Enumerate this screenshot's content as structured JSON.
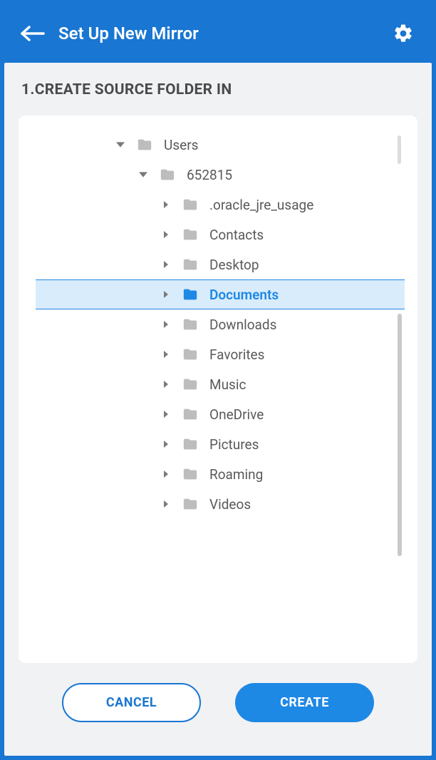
{
  "header": {
    "title": "Set Up New Mirror"
  },
  "section": {
    "title": "1.CREATE SOURCE FOLDER IN"
  },
  "tree": {
    "selectedIndex": 5,
    "nodes": [
      {
        "label": "Users",
        "depth": 0,
        "expanded": true
      },
      {
        "label": "652815",
        "depth": 1,
        "expanded": true
      },
      {
        "label": ".oracle_jre_usage",
        "depth": 2,
        "expanded": false
      },
      {
        "label": "Contacts",
        "depth": 2,
        "expanded": false
      },
      {
        "label": "Desktop",
        "depth": 2,
        "expanded": false
      },
      {
        "label": "Documents",
        "depth": 2,
        "expanded": false
      },
      {
        "label": "Downloads",
        "depth": 2,
        "expanded": false
      },
      {
        "label": "Favorites",
        "depth": 2,
        "expanded": false
      },
      {
        "label": "Music",
        "depth": 2,
        "expanded": false
      },
      {
        "label": "OneDrive",
        "depth": 2,
        "expanded": false
      },
      {
        "label": "Pictures",
        "depth": 2,
        "expanded": false
      },
      {
        "label": "Roaming",
        "depth": 2,
        "expanded": false
      },
      {
        "label": "Videos",
        "depth": 2,
        "expanded": false
      }
    ]
  },
  "footer": {
    "cancel": "CANCEL",
    "create": "CREATE"
  },
  "colors": {
    "primary": "#1976d2",
    "accent": "#1e88e5",
    "selectedBg": "#d9ecfb",
    "folderIdle": "#bdbdbd"
  }
}
